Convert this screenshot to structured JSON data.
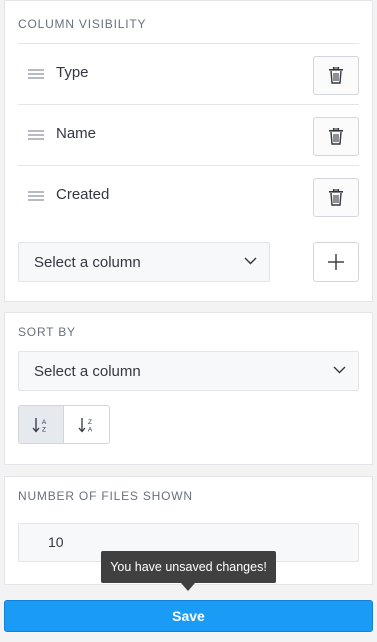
{
  "column_visibility": {
    "title": "COLUMN VISIBILITY",
    "columns": [
      {
        "label": "Type"
      },
      {
        "label": "Name"
      },
      {
        "label": "Created"
      }
    ],
    "add_select": {
      "selected": "Select a column"
    },
    "icons": {
      "drag": "drag-handle-icon",
      "delete": "trash-icon",
      "add": "plus-icon",
      "dropdown": "chevron-down-icon"
    }
  },
  "sort_by": {
    "title": "SORT BY",
    "select": {
      "selected": "Select a column"
    },
    "options": [
      {
        "name": "sort-ascending",
        "active": true
      },
      {
        "name": "sort-descending",
        "active": false
      }
    ]
  },
  "files_shown": {
    "title": "NUMBER OF FILES SHOWN",
    "value": "10"
  },
  "tooltip": {
    "text": "You have unsaved changes!"
  },
  "save": {
    "label": "Save"
  },
  "colors": {
    "primary": "#1a9cf6",
    "tooltip_bg": "#404040"
  }
}
